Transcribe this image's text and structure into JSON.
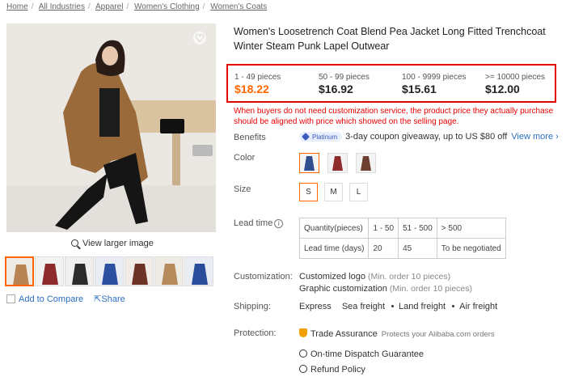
{
  "breadcrumb": [
    "Home",
    "All Industries",
    "Apparel",
    "Women's Clothing",
    "Women's Coats"
  ],
  "gallery": {
    "zoom_label": "View larger image",
    "add_compare": "Add to Compare",
    "share": "Share",
    "thumb_colors": [
      "#b98453",
      "#8c2a2e",
      "#2b2b2b",
      "#2c4fa0",
      "#6d3326",
      "#b68a5a",
      "#2a4d9b",
      "#3a3a3a"
    ]
  },
  "product": {
    "title": "Women's Loosetrench Coat Blend Pea Jacket Long Fitted Trenchcoat Winter Steam Punk Lapel Outwear"
  },
  "price_tiers": [
    {
      "qty": "1 - 49 pieces",
      "price": "$18.22"
    },
    {
      "qty": "50 - 99 pieces",
      "price": "$16.92"
    },
    {
      "qty": "100 - 9999 pieces",
      "price": "$15.61"
    },
    {
      "qty": ">= 10000 pieces",
      "price": "$12.00"
    }
  ],
  "price_note": "When buyers do not need customization service, the product price they actually purchase should be aligned with price which showed on the selling page.",
  "labels": {
    "benefits": "Benefits",
    "color": "Color",
    "size": "Size",
    "lead_time": "Lead time",
    "customization": "Customization:",
    "shipping": "Shipping:",
    "protection": "Protection:"
  },
  "benefits": {
    "badge": "Platinum",
    "text": "3-day coupon giveaway, up to US $80 off",
    "view_more": "View more"
  },
  "colors": [
    "#2f4f8f",
    "#8e2b2b",
    "#6b4030"
  ],
  "sizes": [
    "S",
    "M",
    "L"
  ],
  "lead_time": {
    "row1": [
      "Quantity(pieces)",
      "1 - 50",
      "51 - 500",
      "> 500"
    ],
    "row2": [
      "Lead time (days)",
      "20",
      "45",
      "To be negotiated"
    ]
  },
  "customization": [
    {
      "name": "Customized logo",
      "min": "(Min. order 10 pieces)"
    },
    {
      "name": "Graphic customization",
      "min": "(Min. order 10 pieces)"
    }
  ],
  "shipping": [
    "Express",
    "Sea freight",
    "Land freight",
    "Air freight"
  ],
  "protection": {
    "trade": "Trade Assurance",
    "trade_sub": "Protects your Alibaba.com orders",
    "dispatch": "On-time Dispatch Guarantee",
    "refund": "Refund Policy"
  }
}
